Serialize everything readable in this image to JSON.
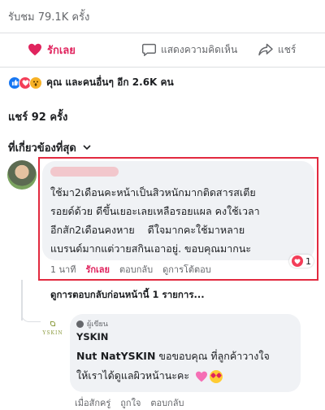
{
  "post": {
    "views": "รับชม 79.1K ครั้ง",
    "actions": {
      "love_label": "รักเลย",
      "comment_label": "แสดงความคิดเห็น",
      "share_label": "แชร์"
    },
    "reactions_text": "คุณ และคนอื่นๆ อีก 2.6K คน",
    "shares_text": "แชร์ 92 ครั้ง",
    "sort_label": "ที่เกี่ยวข้องที่สุด"
  },
  "comment": {
    "text": "ใช้มา2เดือนคะหน้าเป็นสิวหนักมากติดสารสเตีย\nรอยด์ด้วย ดีขึ้นเยอะเลยเหลือรอยแผล คงใช้เวลา\nอีกสัก2เดือนคงหาย    ดีใจมากคะใช้มาหลาย\nแบรนด์มากแต่วายสกินเอาอยู่. ขอบคุณมากนะ",
    "time": "1 นาที",
    "love": "รักเลย",
    "reply": "ตอบกลับ",
    "see_reply": "ดูการโต้ตอบ",
    "reaction_count": "1",
    "previous_replies": "ดูการตอบกลับก่อนหน้านี้ 1 รายการ..."
  },
  "reply": {
    "author_badge": "ผู้เขียน",
    "logo_text": "YSKIN",
    "page_name": "YSKIN",
    "mention": "Nut Nat",
    "mention_page": "YSKIN",
    "line1_rest": " ขอขอบคุณ ที่ลูกค้าวางใจ",
    "line2": "ให้เราได้ดูแลผิวหน้านะคะ ",
    "time": "เมื่อสักครู่",
    "like": "ถูกใจ",
    "reply": "ตอบกลับ"
  },
  "colors": {
    "love_red": "#e0245e",
    "highlight_red": "#e22a3f",
    "bubble_bg": "#f0f2f5",
    "muted_text": "#65676b"
  },
  "icons": {
    "love": "heart-icon",
    "comment": "comment-bubble-icon",
    "share": "share-arrow-icon",
    "sort": "chevron-down-icon"
  }
}
